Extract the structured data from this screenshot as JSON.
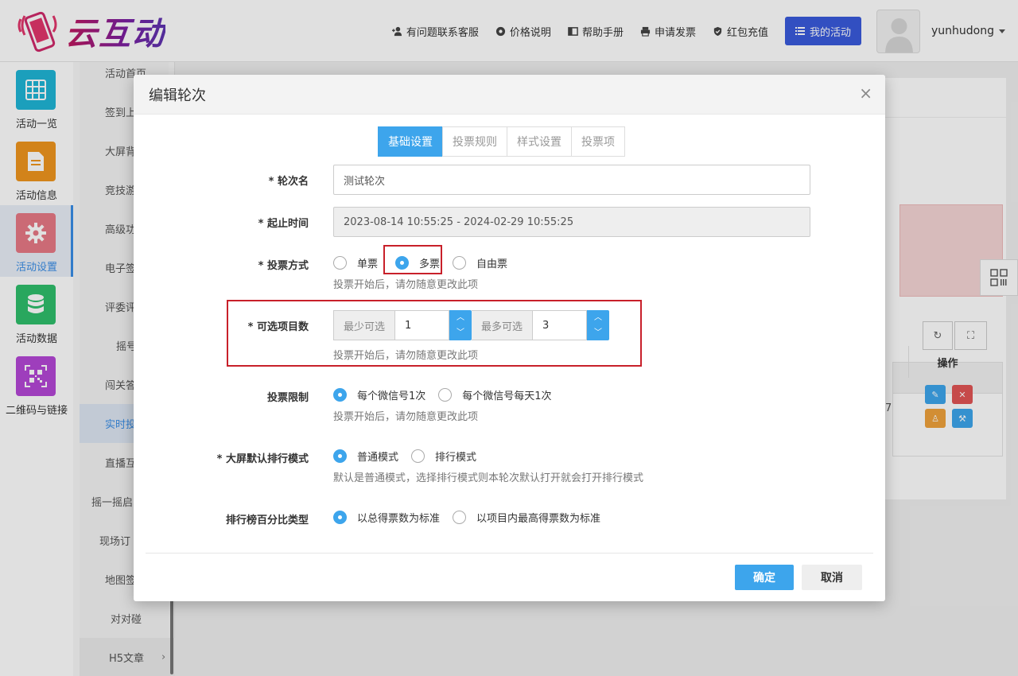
{
  "header": {
    "logo_text": "云互动",
    "nav": [
      {
        "label": "有问题联系客服",
        "icon": "user-plus-icon"
      },
      {
        "label": "价格说明",
        "icon": "gear-icon"
      },
      {
        "label": "帮助手册",
        "icon": "book-icon"
      },
      {
        "label": "申请发票",
        "icon": "printer-icon"
      },
      {
        "label": "红包充值",
        "icon": "check-shield-icon"
      }
    ],
    "my_activity": "我的活动",
    "username": "yunhudong"
  },
  "rail": [
    {
      "label": "活动一览",
      "color": "#1fb5d6",
      "icon": "grid-icon"
    },
    {
      "label": "活动信息",
      "color": "#f0961e",
      "icon": "document-icon"
    },
    {
      "label": "活动设置",
      "color": "#e87986",
      "icon": "gear-icon",
      "active": true
    },
    {
      "label": "活动数据",
      "color": "#2fbf6c",
      "icon": "database-icon"
    },
    {
      "label": "二维码与链接",
      "color": "#b447d6",
      "icon": "qrcode-icon"
    }
  ],
  "subnav": [
    "活动首页",
    "签到上",
    "大屏背",
    "竞技游",
    "高级功",
    "电子签",
    "评委评",
    "摇号",
    "闯关答",
    "实时投",
    "直播互",
    "摇一摇启",
    "现场订",
    "地图签",
    "对对碰",
    "H5文章"
  ],
  "table": {
    "op_header": "操作",
    "cell_value": "7"
  },
  "modal": {
    "title": "编辑轮次",
    "close": "×",
    "tabs": [
      "基础设置",
      "投票规则",
      "样式设置",
      "投票项"
    ],
    "round_name": {
      "label": "* 轮次名",
      "value": "测试轮次"
    },
    "time_range": {
      "label": "* 起止时间",
      "value": "2023-08-14 10:55:25 - 2024-02-29 10:55:25"
    },
    "vote_mode": {
      "label": "* 投票方式",
      "options": [
        "单票",
        "多票",
        "自由票"
      ],
      "selected": "多票",
      "hint": "投票开始后，请勿随意更改此项"
    },
    "option_count": {
      "label": "* 可选项目数",
      "min_label": "最少可选",
      "min_value": "1",
      "max_label": "最多可选",
      "max_value": "3",
      "hint": "投票开始后，请勿随意更改此项"
    },
    "vote_limit": {
      "label": "投票限制",
      "options": [
        "每个微信号1次",
        "每个微信号每天1次"
      ],
      "selected": "每个微信号1次",
      "hint": "投票开始后，请勿随意更改此项"
    },
    "rank_mode": {
      "label": "* 大屏默认排行模式",
      "options": [
        "普通模式",
        "排行模式"
      ],
      "selected": "普通模式",
      "hint": "默认是普通模式，选择排行模式则本轮次默认打开就会打开排行模式"
    },
    "percent_type": {
      "label": "排行榜百分比类型",
      "options": [
        "以总得票数为标准",
        "以项目内最高得票数为标准"
      ],
      "selected": "以总得票数为标准"
    },
    "ok": "确定",
    "cancel": "取消"
  }
}
